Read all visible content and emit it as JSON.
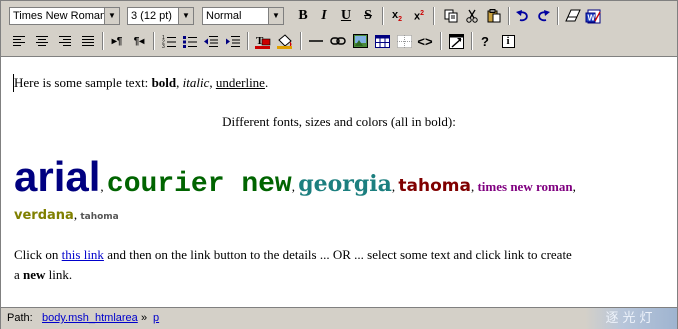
{
  "toolbar": {
    "font_name": "Times New Roman",
    "font_size": "3 (12 pt)",
    "format": "Normal",
    "buttons_row1": [
      "bold",
      "italic",
      "underline",
      "strikethrough",
      "subscript",
      "superscript",
      "copy",
      "cut",
      "paste",
      "undo",
      "redo",
      "clear-format",
      "word-clean"
    ],
    "buttons_row2": [
      "align-left",
      "align-center",
      "align-right",
      "justify",
      "ltr",
      "rtl",
      "ordered-list",
      "unordered-list",
      "outdent",
      "indent",
      "text-color",
      "highlight-color",
      "horizontal-rule",
      "link",
      "image",
      "table",
      "grid",
      "source",
      "popup",
      "help",
      "about"
    ],
    "labels": {
      "bold": "B",
      "italic": "I",
      "underline": "U",
      "strike": "S",
      "sub": "x",
      "sub_mark": "2",
      "sup": "x",
      "sup_mark": "2",
      "help": "?",
      "about": "i"
    }
  },
  "editor": {
    "line1_prefix": "Here is some sample text: ",
    "bold": "bold",
    "sep1": ", ",
    "italic": "italic",
    "sep2": ", ",
    "underline": "underline",
    "period": ".",
    "centered": "Different fonts, sizes and colors (all in bold):",
    "fonts": [
      {
        "text": "arial",
        "color": "#000080",
        "sep": ","
      },
      {
        "text": "courier new",
        "color": "#006400",
        "sep": ","
      },
      {
        "text": "georgia",
        "color": "#1c7f7f",
        "sep": ","
      },
      {
        "text": "tahoma",
        "color": "#800000",
        "sep": ","
      },
      {
        "text": "times new roman",
        "color": "#800080",
        "sep": ","
      },
      {
        "text": "verdana",
        "color": "#808000",
        "sep": ","
      },
      {
        "text": "tahoma",
        "color": "#555555",
        "sep": ""
      }
    ],
    "link_p_1": "Click on ",
    "link_text": "this link",
    "link_p_2": " and then on the link button to the details ... OR ... select some text and click link to create",
    "link_p_3": "a ",
    "link_bold": "new",
    "link_p_4": " link."
  },
  "status": {
    "path_label": "Path:",
    "crumb1": "body.msh_htmlarea",
    "arrow": "»",
    "crumb2": "p",
    "watermark": "逐光灯"
  },
  "colors": {
    "toolbar": "#d4d0c8",
    "link": "#0000cc"
  }
}
